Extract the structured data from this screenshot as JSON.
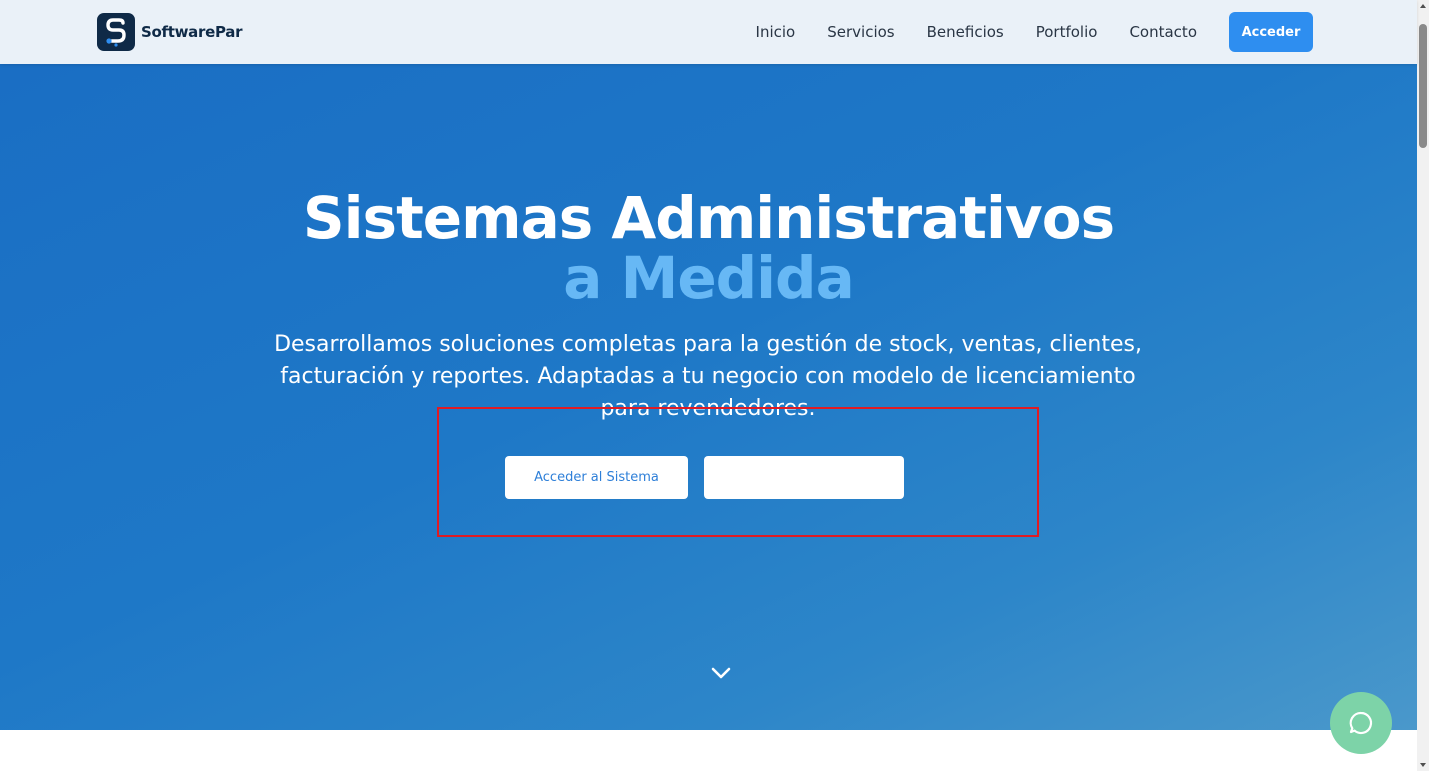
{
  "brand": {
    "name": "SoftwarePar",
    "logo_icon": "s-logo-icon"
  },
  "nav": {
    "links": [
      "Inicio",
      "Servicios",
      "Beneficios",
      "Portfolio",
      "Contacto"
    ],
    "cta_label": "Acceder"
  },
  "hero": {
    "title_line1": "Sistemas Administrativos",
    "title_line2": "a Medida",
    "subtitle": "Desarrollamos soluciones completas para la gestión de stock, ventas, clientes, facturación y reportes. Adaptadas a tu negocio con modelo de licenciamiento para revendedores.",
    "primary_button": "Acceder al Sistema",
    "secondary_button": "",
    "scroll_icon": "chevron-down-icon"
  },
  "chat": {
    "icon": "chat-bubble-icon"
  },
  "colors": {
    "brand_dark": "#0f2a47",
    "accent_blue": "#2e8ef0",
    "hero_accent": "#67b8f5",
    "highlight": "#e01b24",
    "chat_green": "#7dd3a8"
  }
}
